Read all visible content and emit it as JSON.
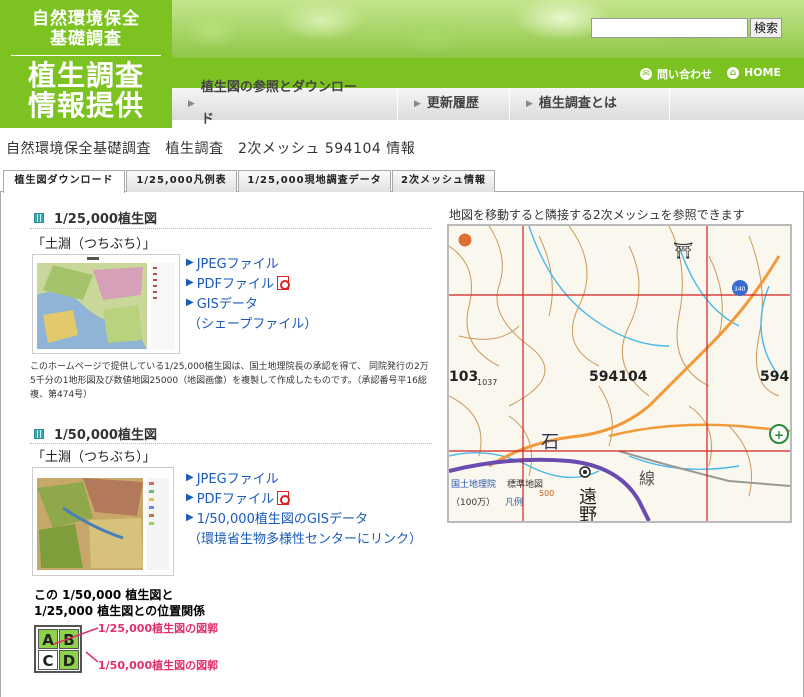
{
  "header": {
    "logo_top_line1": "自然環境保全",
    "logo_top_line2": "基礎調査",
    "logo_main_line1": "植生調査",
    "logo_main_line2": "情報提供",
    "search_placeholder": "",
    "search_button": "検索",
    "contact_label": "問い合わせ",
    "home_label": "HOME"
  },
  "nav": {
    "items": [
      {
        "label": "植生図の参照とダウンロード"
      },
      {
        "label": "更新履歴"
      },
      {
        "label": "植生調査とは"
      }
    ]
  },
  "page_title": "自然環境保全基礎調査　植生調査　2次メッシュ 594104 情報",
  "tabs": [
    {
      "label": "植生図ダウンロード",
      "active": true
    },
    {
      "label": "1/25,000凡例表",
      "active": false
    },
    {
      "label": "1/25,000現地調査データ",
      "active": false
    },
    {
      "label": "2次メッシュ情報",
      "active": false
    }
  ],
  "section_25000": {
    "heading": "1/25,000植生図",
    "sheet_name": "「土淵（つちぶち）」",
    "links": {
      "jpeg": "JPEGファイル",
      "pdf": "PDFファイル",
      "gis": "GISデータ",
      "gis_note": "（シェープファイル）"
    },
    "note": "このホームページで提供している1/25,000植生図は、国土地理院長の承認を得て、 同院発行の2万5千分の1地形図及び数値地図25000（地図画像）を複製して作成したものです。（承認番号平16総複、第474号）"
  },
  "section_50000": {
    "heading": "1/50,000植生図",
    "sheet_name": "「土淵（つちぶち）」",
    "links": {
      "jpeg": "JPEGファイル",
      "pdf": "PDFファイル",
      "gis": "1/50,000植生図のGISデータ",
      "gis_note": "（環境省生物多様性センターにリンク）"
    }
  },
  "map": {
    "caption": "地図を移動すると隣接する2次メッシュを参照できます",
    "center_mesh": "594104",
    "left_mesh_partial": "103",
    "right_mesh_partial": "594",
    "route_number": "340",
    "elevation_1": "1037",
    "elevation_2": "500",
    "place_kanji_1": "石",
    "place_kanji_2": "遠",
    "place_kanji_3": "野",
    "place_kanji_4": "線",
    "attribution_link": "国土地理院",
    "attribution_text": "標準地図",
    "attribution_scale": "（100万）",
    "legend_link": "凡例"
  },
  "legend": {
    "title_line1": "この 1/50,000 植生図と",
    "title_line2": "1/25,000 植生図との位置関係",
    "cells": [
      "A",
      "B",
      "C",
      "D"
    ],
    "label_25000": "1/25,000植生図の図郭",
    "label_50000": "1/50,000植生図の図郭"
  },
  "colors": {
    "brand_green": "#7cc322",
    "link_blue": "#1a5ab8",
    "legend_pink": "#e0306a",
    "grid_red": "#d42020",
    "cell_green": "#8cd24a"
  }
}
